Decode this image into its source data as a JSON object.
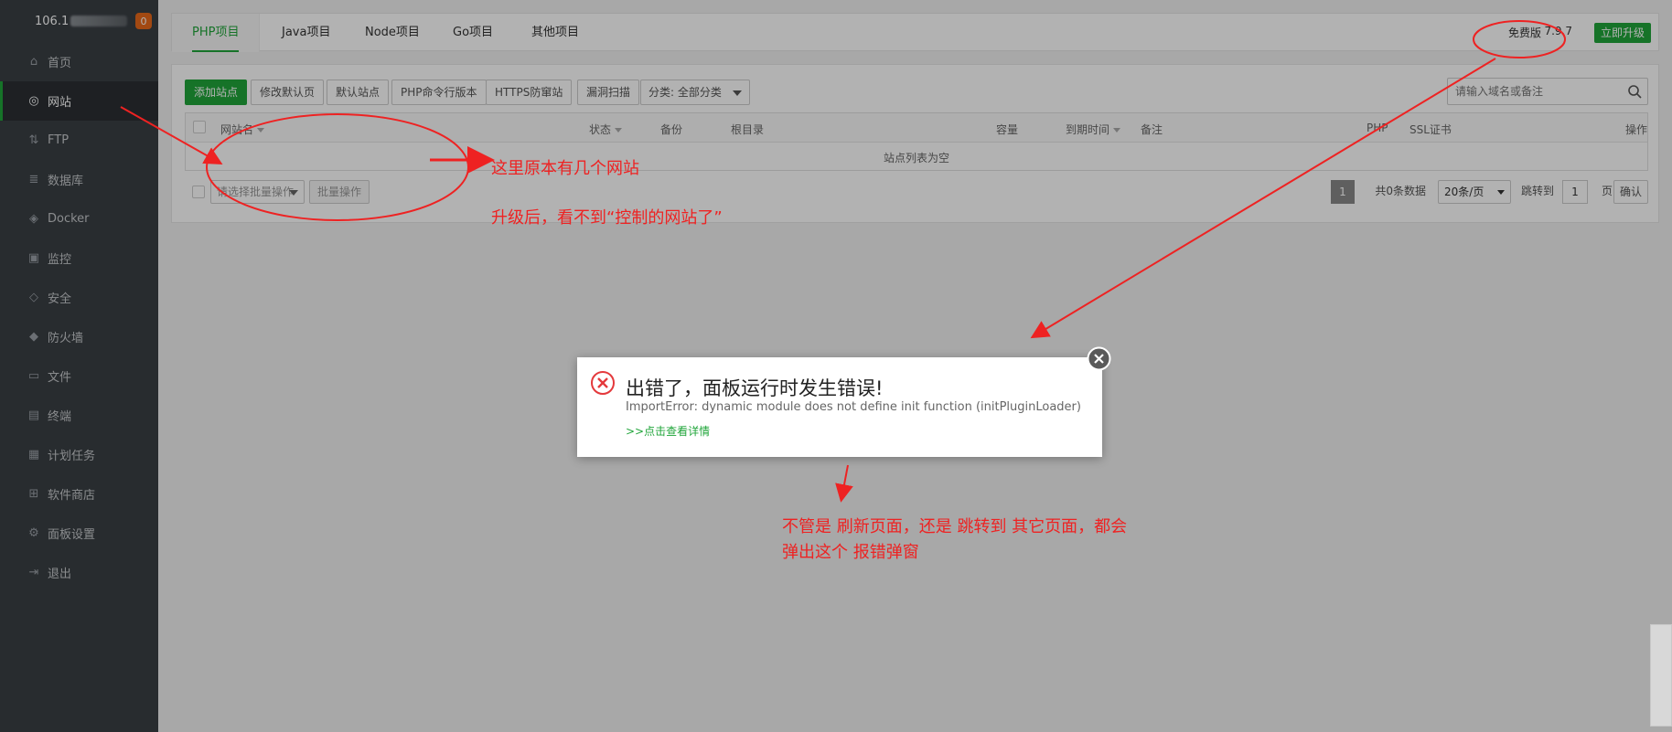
{
  "sidebar": {
    "ip": "106.1",
    "badge": "0",
    "items": [
      {
        "label": "首页",
        "icon": "home-icon",
        "glyph": "⌂"
      },
      {
        "label": "网站",
        "icon": "globe-icon",
        "glyph": "◎",
        "active": true
      },
      {
        "label": "FTP",
        "icon": "ftp-icon",
        "glyph": "⇅"
      },
      {
        "label": "数据库",
        "icon": "database-icon",
        "glyph": "≣"
      },
      {
        "label": "Docker",
        "icon": "docker-icon",
        "glyph": "◈"
      },
      {
        "label": "监控",
        "icon": "monitor-icon",
        "glyph": "▣"
      },
      {
        "label": "安全",
        "icon": "shield-icon",
        "glyph": "◇"
      },
      {
        "label": "防火墙",
        "icon": "firewall-icon",
        "glyph": "◆"
      },
      {
        "label": "文件",
        "icon": "folder-icon",
        "glyph": "▭"
      },
      {
        "label": "终端",
        "icon": "terminal-icon",
        "glyph": "▤"
      },
      {
        "label": "计划任务",
        "icon": "calendar-icon",
        "glyph": "▦"
      },
      {
        "label": "软件商店",
        "icon": "grid-icon",
        "glyph": "⊞"
      },
      {
        "label": "面板设置",
        "icon": "gear-icon",
        "glyph": "⚙"
      },
      {
        "label": "退出",
        "icon": "logout-icon",
        "glyph": "⇥"
      }
    ]
  },
  "topbar": {
    "tabs": [
      "PHP项目",
      "Java项目",
      "Node项目",
      "Go项目",
      "其他项目"
    ],
    "edition": "免费版",
    "version": "7.9.7",
    "upgrade": "立即升级"
  },
  "toolbar": {
    "add_site": "添加站点",
    "edit_default_page": "修改默认页",
    "default_site": "默认站点",
    "php_cli": "PHP命令行版本",
    "https_guard": "HTTPS防窜站",
    "vuln_scan": "漏洞扫描",
    "category": "分类: 全部分类",
    "search_placeholder": "请输入域名或备注"
  },
  "table": {
    "headers": {
      "name": "网站名",
      "status": "状态",
      "backup": "备份",
      "root": "根目录",
      "capacity": "容量",
      "expire": "到期时间",
      "remark": "备注",
      "php": "PHP",
      "ssl": "SSL证书",
      "ops": "操作"
    },
    "empty": "站点列表为空"
  },
  "batch": {
    "select_placeholder": "请选择批量操作",
    "button": "批量操作"
  },
  "pager": {
    "current": "1",
    "total": "共0条数据",
    "page_size": "20条/页",
    "jump_to": "跳转到",
    "jump_value": "1",
    "page_unit": "页",
    "confirm": "确认"
  },
  "dialog": {
    "title": "出错了，面板运行时发生错误!",
    "message": "ImportError: dynamic module does not define init function (initPluginLoader)",
    "link": ">>点击查看详情"
  },
  "annotations": {
    "note1": "这里原本有几个网站",
    "note2": "升级后，看不到“控制的网站了”",
    "note3_line1": "不管是 刷新页面，还是 跳转到 其它页面，都会",
    "note3_line2": "弹出这个  报错弹窗",
    "color": "#ee2222"
  },
  "colors": {
    "accent": "#20a53a",
    "sidebar_bg": "#3a3f44",
    "badge": "#e8691b"
  }
}
